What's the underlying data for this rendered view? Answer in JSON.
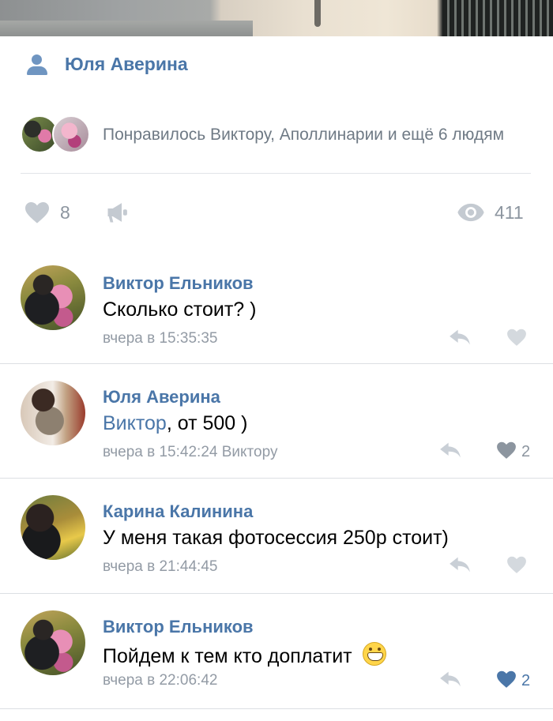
{
  "post": {
    "author": "Юля Аверина",
    "likers_text": "Понравилось Виктору, Аполлинарии и ещё 6 людям",
    "like_count": "8",
    "view_count": "411"
  },
  "comments": [
    {
      "author": "Виктор Ельников",
      "text": "Сколько стоит? )",
      "time": "вчера в 15:35:35",
      "likes": "",
      "liked": false
    },
    {
      "author": "Юля Аверина",
      "mention": "Виктор",
      "text": ", от 500 )",
      "time": "вчера в 15:42:24 Виктору",
      "likes": "2",
      "liked": false
    },
    {
      "author": "Карина Калинина",
      "text": "У меня такая фотосессия 250р стоит)",
      "time": "вчера в 21:44:45",
      "likes": "",
      "liked": false
    },
    {
      "author": "Виктор Ельников",
      "text": "Пойдем  к тем кто доплатит ",
      "emoji": "grinning-face-emoji",
      "time": "вчера в 22:06:42",
      "likes": "2",
      "liked": true
    }
  ],
  "colors": {
    "accent": "#4a76a8",
    "icon_grey": "#c4cad1",
    "liked_blue": "#4a76a8"
  },
  "icons": [
    "person-icon",
    "heart-icon",
    "megaphone-icon",
    "eye-icon",
    "reply-icon"
  ]
}
